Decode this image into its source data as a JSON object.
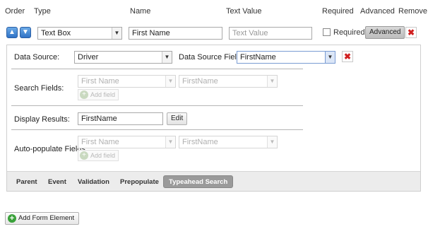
{
  "headers": {
    "order": "Order",
    "type": "Type",
    "name": "Name",
    "text_value": "Text Value",
    "required": "Required",
    "advanced": "Advanced",
    "remove": "Remove"
  },
  "row": {
    "move_up_icon": "arrow-up-icon",
    "move_down_icon": "arrow-down-icon",
    "type_value": "Text Box",
    "name_value": "First Name",
    "text_value_placeholder": "Text Value",
    "required_label": "Required",
    "required_checked": false,
    "advanced_label": "Advanced",
    "remove_icon": "x-icon"
  },
  "panel": {
    "data_source_label": "Data Source:",
    "data_source_value": "Driver",
    "data_source_field_label": "Data Source Field:",
    "data_source_field_value": "FirstName",
    "search_fields_label": "Search Fields:",
    "search_field_1": "First Name",
    "search_field_2": "FirstName",
    "add_field_label": "Add field",
    "display_results_label": "Display Results:",
    "display_results_value": "FirstName",
    "edit_label": "Edit",
    "autopopulate_label": "Auto-populate Fields:",
    "auto_field_1": "First Name",
    "auto_field_2": "FirstName",
    "auto_add_field_label": "Add field"
  },
  "tabs": [
    {
      "label": "Parent"
    },
    {
      "label": "Event"
    },
    {
      "label": "Validation"
    },
    {
      "label": "Prepopulate"
    },
    {
      "label": "Typeahead Search",
      "active": true
    }
  ],
  "footer": {
    "add_form_element_label": "Add Form Element"
  },
  "colors": {
    "remove_red": "#d02020",
    "active_tab_bg": "#9a9a9a",
    "add_green": "#3aa13a",
    "arrow_blue": "#2f72c6"
  }
}
